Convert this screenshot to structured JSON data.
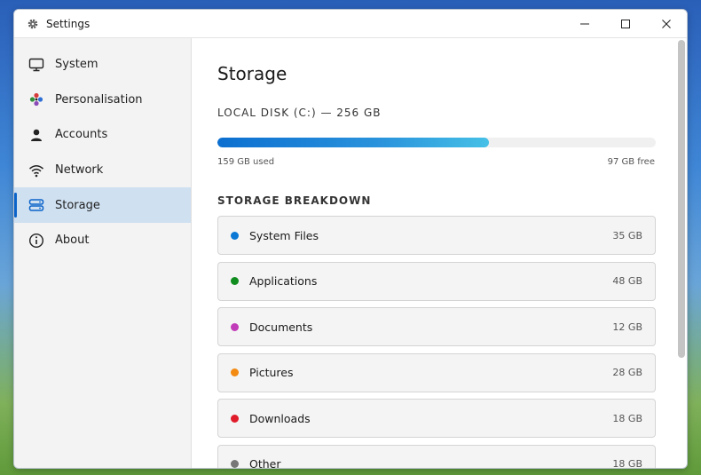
{
  "window": {
    "title": "Settings"
  },
  "sidebar": {
    "items": [
      {
        "label": "System",
        "icon": "monitor-icon"
      },
      {
        "label": "Personalisation",
        "icon": "palette-icon"
      },
      {
        "label": "Accounts",
        "icon": "person-icon"
      },
      {
        "label": "Network",
        "icon": "wifi-icon"
      },
      {
        "label": "Storage",
        "icon": "storage-icon",
        "active": true
      },
      {
        "label": "About",
        "icon": "info-icon"
      }
    ]
  },
  "main": {
    "title": "Storage",
    "disk_label": "LOCAL DISK (C:) — 256 GB",
    "used_fraction": 0.62,
    "used_text": "159 GB used",
    "free_text": "97 GB free",
    "breakdown_title": "STORAGE BREAKDOWN",
    "breakdown": [
      {
        "name": "System Files",
        "size": "35 GB",
        "color": "#0a78d4"
      },
      {
        "name": "Applications",
        "size": "48 GB",
        "color": "#118c1e"
      },
      {
        "name": "Documents",
        "size": "12 GB",
        "color": "#c13cb8"
      },
      {
        "name": "Pictures",
        "size": "28 GB",
        "color": "#f38a12"
      },
      {
        "name": "Downloads",
        "size": "18 GB",
        "color": "#e01c2a"
      },
      {
        "name": "Other",
        "size": "18 GB",
        "color": "#777777"
      }
    ]
  },
  "colors": {
    "accent": "#0a63c9",
    "active_bg": "#cfe0f1"
  }
}
